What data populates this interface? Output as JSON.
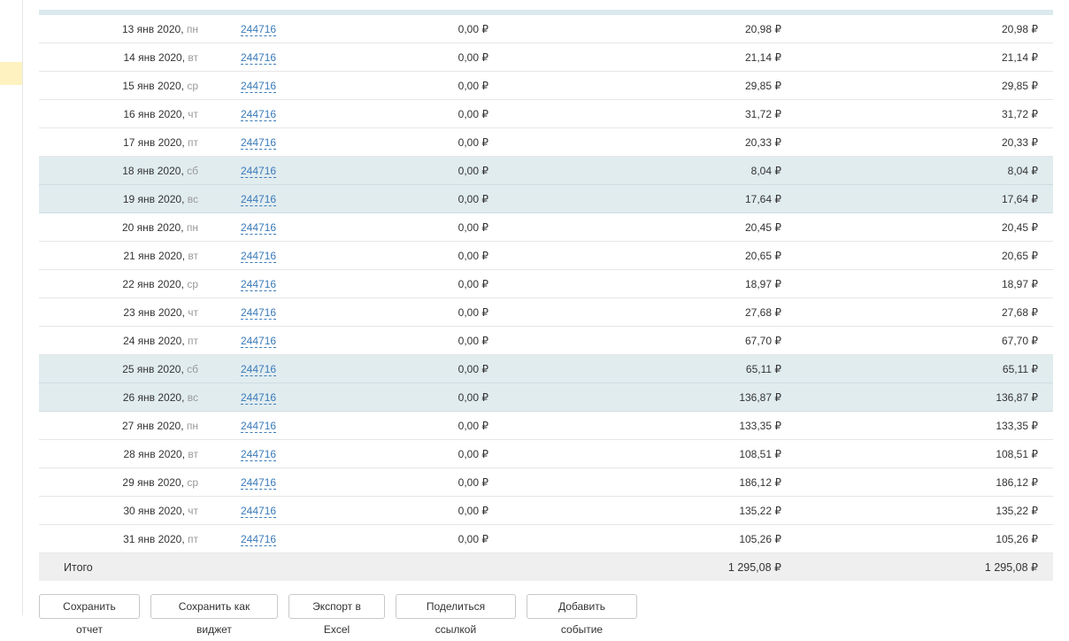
{
  "table": {
    "rows": [
      {
        "date": "13 янв 2020,",
        "dow": "пн",
        "id": "244716",
        "col1": "0,00 ₽",
        "col2": "20,98 ₽",
        "col3": "20,98 ₽",
        "weekend": false
      },
      {
        "date": "14 янв 2020,",
        "dow": "вт",
        "id": "244716",
        "col1": "0,00 ₽",
        "col2": "21,14 ₽",
        "col3": "21,14 ₽",
        "weekend": false
      },
      {
        "date": "15 янв 2020,",
        "dow": "ср",
        "id": "244716",
        "col1": "0,00 ₽",
        "col2": "29,85 ₽",
        "col3": "29,85 ₽",
        "weekend": false
      },
      {
        "date": "16 янв 2020,",
        "dow": "чт",
        "id": "244716",
        "col1": "0,00 ₽",
        "col2": "31,72 ₽",
        "col3": "31,72 ₽",
        "weekend": false
      },
      {
        "date": "17 янв 2020,",
        "dow": "пт",
        "id": "244716",
        "col1": "0,00 ₽",
        "col2": "20,33 ₽",
        "col3": "20,33 ₽",
        "weekend": false
      },
      {
        "date": "18 янв 2020,",
        "dow": "сб",
        "id": "244716",
        "col1": "0,00 ₽",
        "col2": "8,04 ₽",
        "col3": "8,04 ₽",
        "weekend": true
      },
      {
        "date": "19 янв 2020,",
        "dow": "вс",
        "id": "244716",
        "col1": "0,00 ₽",
        "col2": "17,64 ₽",
        "col3": "17,64 ₽",
        "weekend": true
      },
      {
        "date": "20 янв 2020,",
        "dow": "пн",
        "id": "244716",
        "col1": "0,00 ₽",
        "col2": "20,45 ₽",
        "col3": "20,45 ₽",
        "weekend": false
      },
      {
        "date": "21 янв 2020,",
        "dow": "вт",
        "id": "244716",
        "col1": "0,00 ₽",
        "col2": "20,65 ₽",
        "col3": "20,65 ₽",
        "weekend": false
      },
      {
        "date": "22 янв 2020,",
        "dow": "ср",
        "id": "244716",
        "col1": "0,00 ₽",
        "col2": "18,97 ₽",
        "col3": "18,97 ₽",
        "weekend": false
      },
      {
        "date": "23 янв 2020,",
        "dow": "чт",
        "id": "244716",
        "col1": "0,00 ₽",
        "col2": "27,68 ₽",
        "col3": "27,68 ₽",
        "weekend": false
      },
      {
        "date": "24 янв 2020,",
        "dow": "пт",
        "id": "244716",
        "col1": "0,00 ₽",
        "col2": "67,70 ₽",
        "col3": "67,70 ₽",
        "weekend": false
      },
      {
        "date": "25 янв 2020,",
        "dow": "сб",
        "id": "244716",
        "col1": "0,00 ₽",
        "col2": "65,11 ₽",
        "col3": "65,11 ₽",
        "weekend": true
      },
      {
        "date": "26 янв 2020,",
        "dow": "вс",
        "id": "244716",
        "col1": "0,00 ₽",
        "col2": "136,87 ₽",
        "col3": "136,87 ₽",
        "weekend": true
      },
      {
        "date": "27 янв 2020,",
        "dow": "пн",
        "id": "244716",
        "col1": "0,00 ₽",
        "col2": "133,35 ₽",
        "col3": "133,35 ₽",
        "weekend": false
      },
      {
        "date": "28 янв 2020,",
        "dow": "вт",
        "id": "244716",
        "col1": "0,00 ₽",
        "col2": "108,51 ₽",
        "col3": "108,51 ₽",
        "weekend": false
      },
      {
        "date": "29 янв 2020,",
        "dow": "ср",
        "id": "244716",
        "col1": "0,00 ₽",
        "col2": "186,12 ₽",
        "col3": "186,12 ₽",
        "weekend": false
      },
      {
        "date": "30 янв 2020,",
        "dow": "чт",
        "id": "244716",
        "col1": "0,00 ₽",
        "col2": "135,22 ₽",
        "col3": "135,22 ₽",
        "weekend": false
      },
      {
        "date": "31 янв 2020,",
        "dow": "пт",
        "id": "244716",
        "col1": "0,00 ₽",
        "col2": "105,26 ₽",
        "col3": "105,26 ₽",
        "weekend": false
      }
    ],
    "total": {
      "label": "Итого",
      "col2": "1 295,08 ₽",
      "col3": "1 295,08 ₽"
    }
  },
  "toolbar": {
    "save_report": "Сохранить отчет",
    "save_widget": "Сохранить как виджет",
    "export_excel": "Экспорт в Excel",
    "share_link": "Поделиться ссылкой",
    "add_event": "Добавить событие"
  },
  "colors": {
    "weekend_row": "#e1ecef",
    "link": "#3a7ab8",
    "total_row": "#efefef",
    "sidebar_highlight": "#fdf2c0"
  }
}
